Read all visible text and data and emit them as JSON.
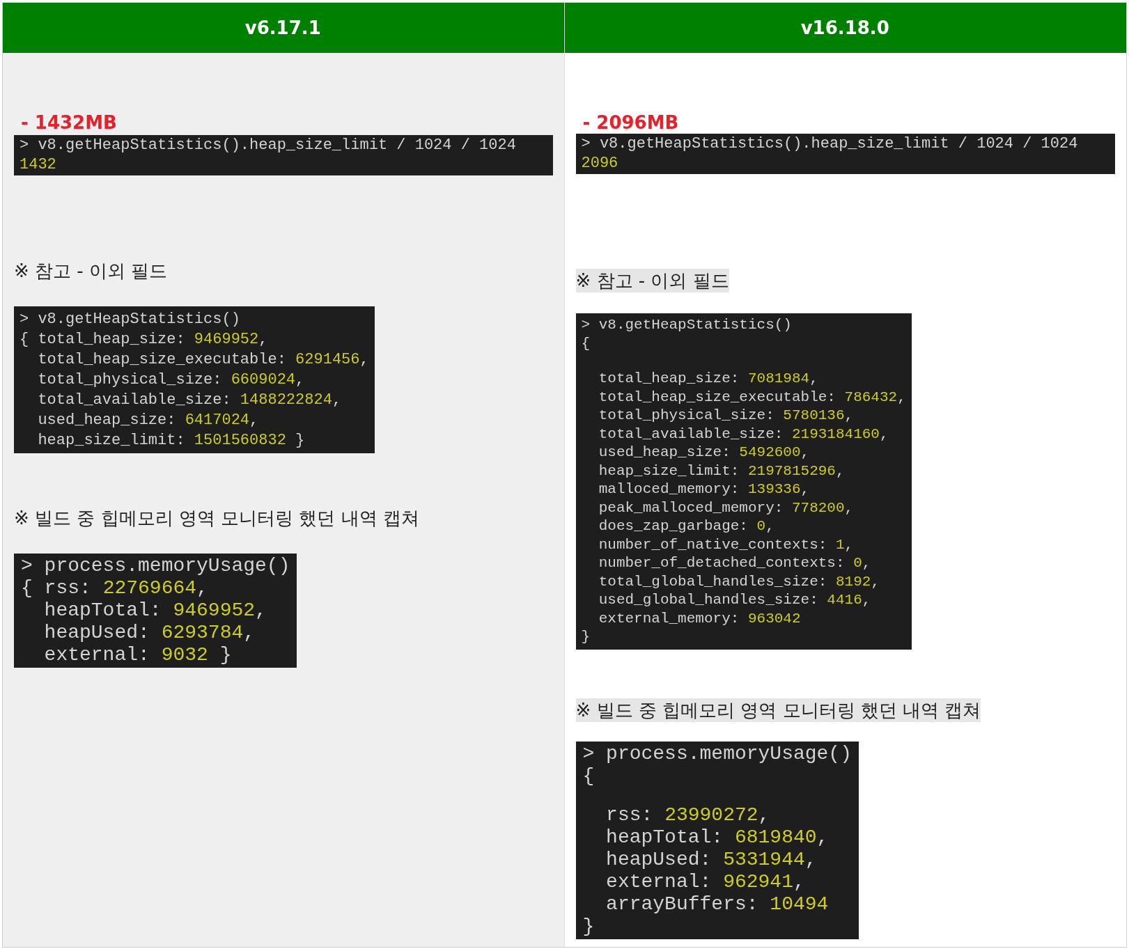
{
  "columns": [
    {
      "header": "v6.17.1",
      "shaded": true,
      "items": [
        {
          "kind": "heading",
          "text": "- 1432MB"
        },
        {
          "kind": "command",
          "lines": [
            {
              "text": "> v8.getHeapStatistics().heap_size_limit / 1024 / 1024"
            },
            {
              "value": "1432"
            }
          ]
        },
        {
          "kind": "note",
          "text": "※ 참고 - 이외 필드"
        },
        {
          "kind": "terminal",
          "lines": [
            {
              "text": "> v8.getHeapStatistics()"
            },
            {
              "text": "{ total_heap_size: ",
              "value": "9469952",
              "end": ","
            },
            {
              "text": "  total_heap_size_executable: ",
              "value": "6291456",
              "end": ","
            },
            {
              "text": "  total_physical_size: ",
              "value": "6609024",
              "end": ","
            },
            {
              "text": "  total_available_size: ",
              "value": "1488222824",
              "end": ","
            },
            {
              "text": "  used_heap_size: ",
              "value": "6417024",
              "end": ","
            },
            {
              "text": "  heap_size_limit: ",
              "value": "1501560832",
              "end": " }"
            }
          ]
        },
        {
          "kind": "note",
          "text": "※ 빌드 중 힙메모리 영역 모니터링 했던 내역 캡쳐"
        },
        {
          "kind": "large",
          "lines": [
            {
              "text": "> process.memoryUsage()"
            },
            {
              "text": "{ rss: ",
              "value": "22769664",
              "end": ","
            },
            {
              "text": "  heapTotal: ",
              "value": "9469952",
              "end": ","
            },
            {
              "text": "  heapUsed: ",
              "value": "6293784",
              "end": ","
            },
            {
              "text": "  external: ",
              "value": "9032",
              "end": " }"
            }
          ]
        }
      ]
    },
    {
      "header": "v16.18.0",
      "shaded": false,
      "items": [
        {
          "kind": "heading",
          "text": "- 2096MB"
        },
        {
          "kind": "command",
          "lines": [
            {
              "text": "> v8.getHeapStatistics().heap_size_limit / 1024 / 1024"
            },
            {
              "value": "2096"
            }
          ]
        },
        {
          "kind": "note",
          "text": "※ 참고 - 이외 필드",
          "highlighted": true
        },
        {
          "kind": "terminal",
          "lines": [
            {
              "text": "> v8.getHeapStatistics()"
            },
            {
              "text": "{"
            },
            {
              "text": "  total_heap_size: ",
              "value": "7081984",
              "end": ",",
              "gap_before": true
            },
            {
              "text": "  total_heap_size_executable: ",
              "value": "786432",
              "end": ","
            },
            {
              "text": "  total_physical_size: ",
              "value": "5780136",
              "end": ","
            },
            {
              "text": "  total_available_size: ",
              "value": "2193184160",
              "end": ","
            },
            {
              "text": "  used_heap_size: ",
              "value": "5492600",
              "end": ","
            },
            {
              "text": "  heap_size_limit: ",
              "value": "2197815296",
              "end": ","
            },
            {
              "text": "  malloced_memory: ",
              "value": "139336",
              "end": ","
            },
            {
              "text": "  peak_malloced_memory: ",
              "value": "778200",
              "end": ","
            },
            {
              "text": "  does_zap_garbage: ",
              "value": "0",
              "end": ","
            },
            {
              "text": "  number_of_native_contexts: ",
              "value": "1",
              "end": ","
            },
            {
              "text": "  number_of_detached_contexts: ",
              "value": "0",
              "end": ","
            },
            {
              "text": "  total_global_handles_size: ",
              "value": "8192",
              "end": ","
            },
            {
              "text": "  used_global_handles_size: ",
              "value": "4416",
              "end": ","
            },
            {
              "text": "  external_memory: ",
              "value": "963042"
            },
            {
              "text": "}"
            }
          ]
        },
        {
          "kind": "note",
          "text": "※ 빌드 중 힙메모리 영역 모니터링 했던 내역 캡쳐",
          "highlighted": true
        },
        {
          "kind": "large",
          "lines": [
            {
              "text": "> process.memoryUsage()"
            },
            {
              "text": "{"
            },
            {
              "text": "  rss: ",
              "value": "23990272",
              "end": ",",
              "gap_before": true
            },
            {
              "text": "  heapTotal: ",
              "value": "6819840",
              "end": ","
            },
            {
              "text": "  heapUsed: ",
              "value": "5331944",
              "end": ","
            },
            {
              "text": "  external: ",
              "value": "962941",
              "end": ","
            },
            {
              "text": "  arrayBuffers: ",
              "value": "10494"
            },
            {
              "text": "}"
            }
          ]
        }
      ]
    }
  ]
}
